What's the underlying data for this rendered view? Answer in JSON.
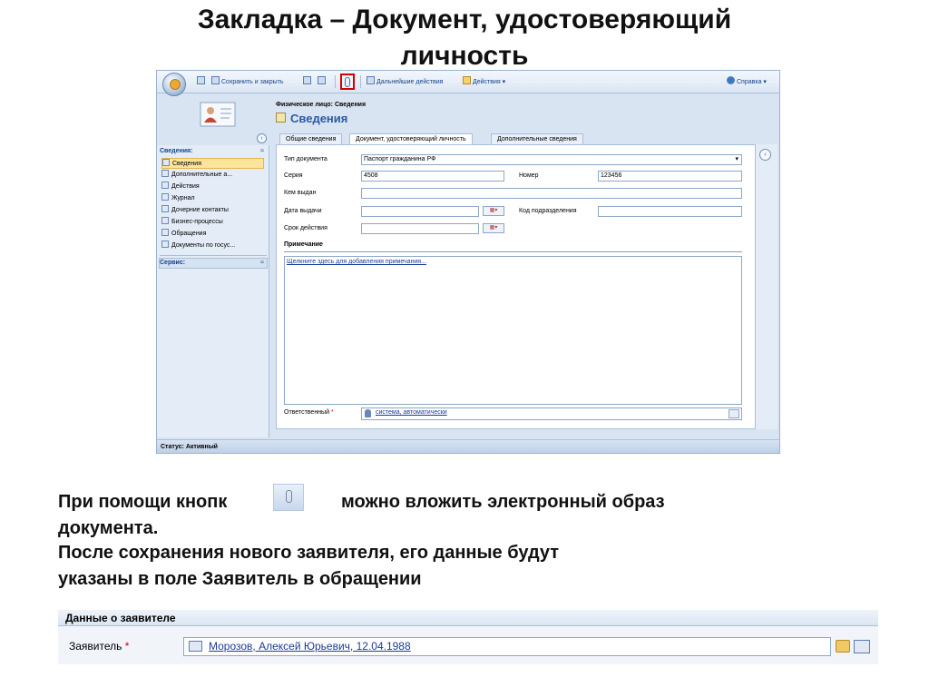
{
  "slide": {
    "title_line1": "Закладка – Документ, удостоверяющий",
    "title_line2": "личность"
  },
  "toolbar": {
    "save_close": "Сохранить и закрыть",
    "further_actions": "Дальнейшие действия",
    "actions": "Действия",
    "help": "Справка"
  },
  "record": {
    "entity_label": "Физическое лицо: Сведения",
    "title": "Сведения"
  },
  "nav": {
    "section_title": "Сведения:",
    "items": [
      {
        "label": "Сведения",
        "icon": "card-icon"
      },
      {
        "label": "Дополнительные а...",
        "icon": "page-icon"
      },
      {
        "label": "Действия",
        "icon": "pencil-icon"
      },
      {
        "label": "Журнал",
        "icon": "journal-icon"
      },
      {
        "label": "Дочерние контакты",
        "icon": "contacts-icon"
      },
      {
        "label": "Бизнес-процессы",
        "icon": "gears-icon"
      },
      {
        "label": "Обращения",
        "icon": "cases-icon"
      },
      {
        "label": "Документы по госус...",
        "icon": "docs-icon"
      }
    ],
    "service_title": "Сервис:"
  },
  "tabs": [
    {
      "label": "Общие сведения"
    },
    {
      "label": "Документ, удостоверяющий личность"
    },
    {
      "label": "Дополнительные сведения"
    }
  ],
  "form": {
    "doc_type_label": "Тип документа",
    "doc_type_value": "Паспорт гражданина РФ",
    "series_label": "Серия",
    "series_value": "4508",
    "number_label": "Номер",
    "number_value": "123456",
    "issued_by_label": "Кем выдан",
    "issue_date_label": "Дата выдачи",
    "dept_code_label": "Код подразделения",
    "validity_label": "Срок действия",
    "note_title": "Примечание",
    "note_placeholder": "Щелкните здесь для добавления примечания...",
    "owner_label": "Ответственный",
    "owner_required": "*",
    "owner_value": "система, автоматически"
  },
  "status": {
    "text": "Статус: Активный"
  },
  "explanation": {
    "line1a": "При помощи кнопк",
    "line1b": "можно вложить электронный образ",
    "line2": "документа.",
    "line3": "После сохранения нового заявителя, его данные будут",
    "line4": "указаны в поле Заявитель в обращении"
  },
  "applicant": {
    "section_title": "Данные о заявителе",
    "label": "Заявитель",
    "required": "*",
    "value": "Морозов, Алексей Юрьевич, 12.04.1988"
  },
  "colors": {
    "link": "#1c3c98",
    "highlight_border": "#d40000",
    "active_nav": "#fde49b"
  }
}
